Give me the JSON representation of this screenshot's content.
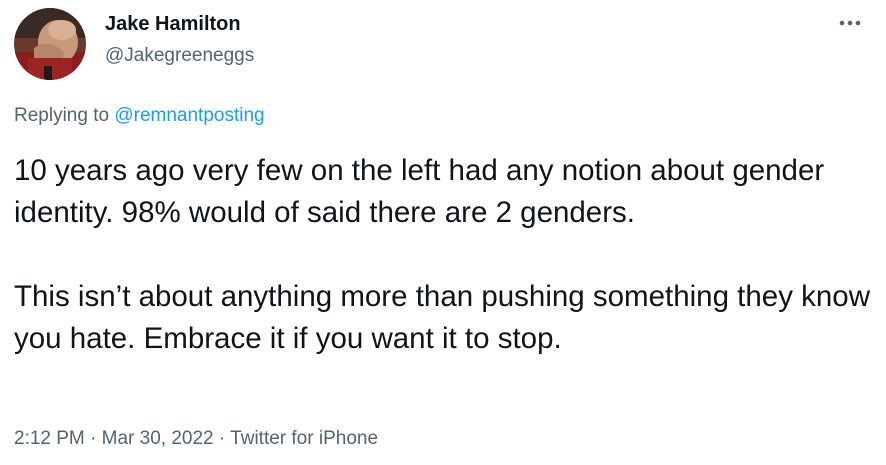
{
  "author": {
    "display_name": "Jake Hamilton",
    "handle": "@Jakegreeneggs",
    "avatar_icon": "avatar-facepalm-photo"
  },
  "reply": {
    "prefix": "Replying to ",
    "mention": "@remnantposting"
  },
  "tweet": {
    "paragraph1": "10 years ago very few on the left had any notion about gender identity.  98% would of said there are 2 genders.",
    "paragraph2": "This isn’t about anything more than pushing something they know you hate. Embrace it if you want it to stop."
  },
  "meta": {
    "time": "2:12 PM",
    "separator1": " · ",
    "date": "Mar 30, 2022",
    "separator2": " · ",
    "source": "Twitter for iPhone"
  },
  "colors": {
    "text": "#0f1419",
    "secondary": "#536471",
    "link": "#1d9bf0"
  },
  "icons": {
    "more": "more-horizontal-icon"
  }
}
